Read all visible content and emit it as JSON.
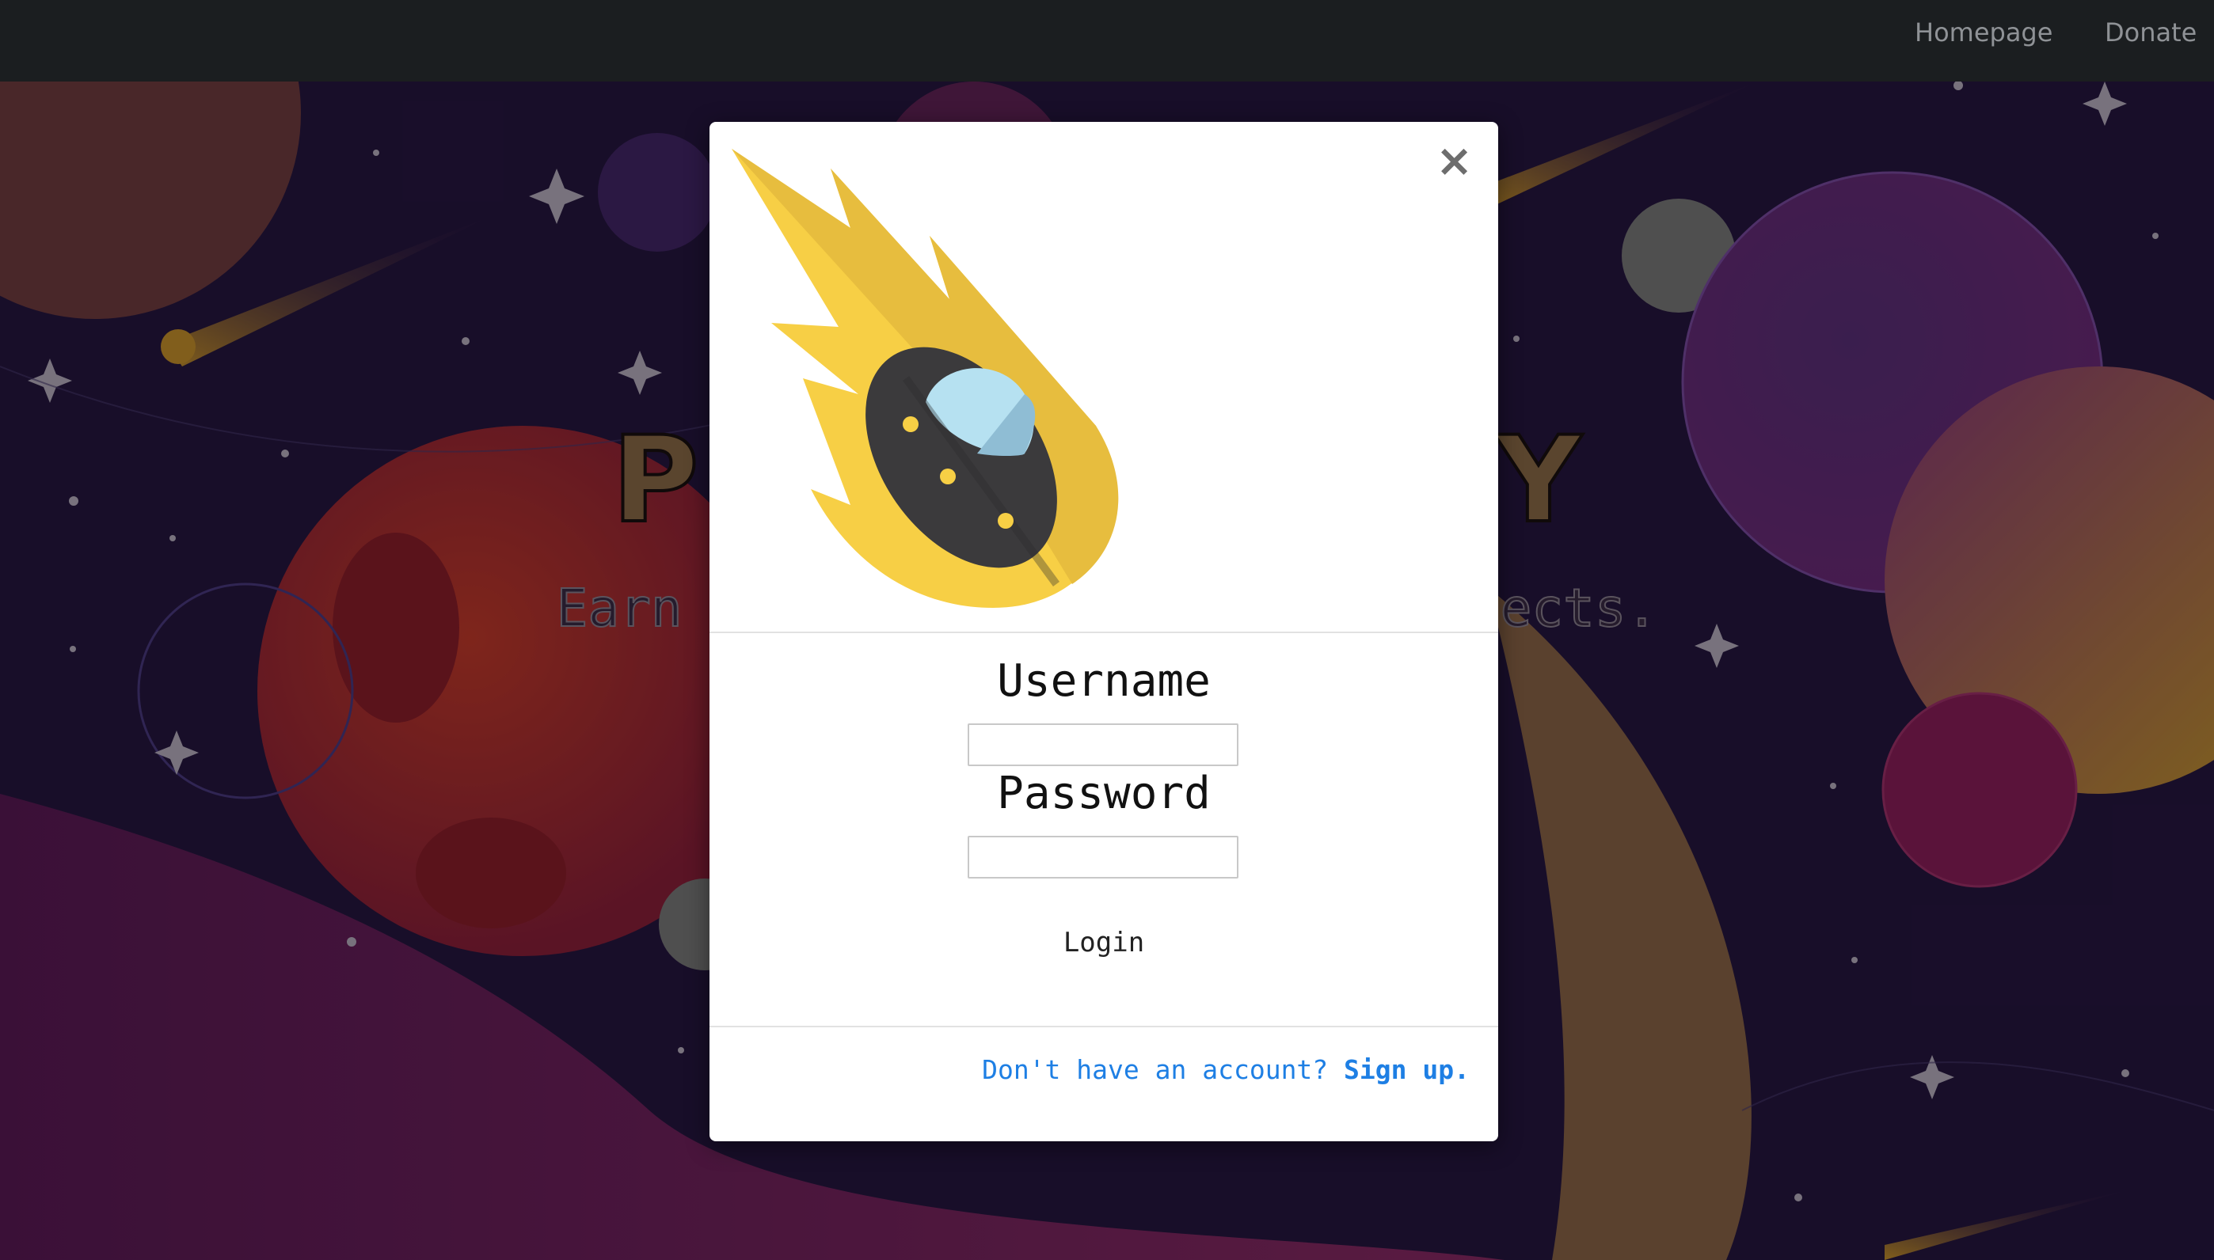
{
  "navbar": {
    "links": [
      "Homepage",
      "Donate"
    ]
  },
  "hero": {
    "title": "PROJECTIFY",
    "subtitle": "Earn points by completing projects."
  },
  "modal": {
    "close_symbol": "×",
    "logo_icon": "flaming-ufo-icon",
    "username_label": "Username",
    "username_value": "",
    "password_label": "Password",
    "password_value": "",
    "login_label": "Login",
    "footer_prompt": "Don't have an account?",
    "signup_label": "Sign up."
  },
  "colors": {
    "navbar": "#1b1e20",
    "link_blue": "#1e7fe4",
    "flame_yellow": "#f7cf45",
    "ufo_dark": "#3b3a3c",
    "dome_blue": "#b6e1f1"
  }
}
